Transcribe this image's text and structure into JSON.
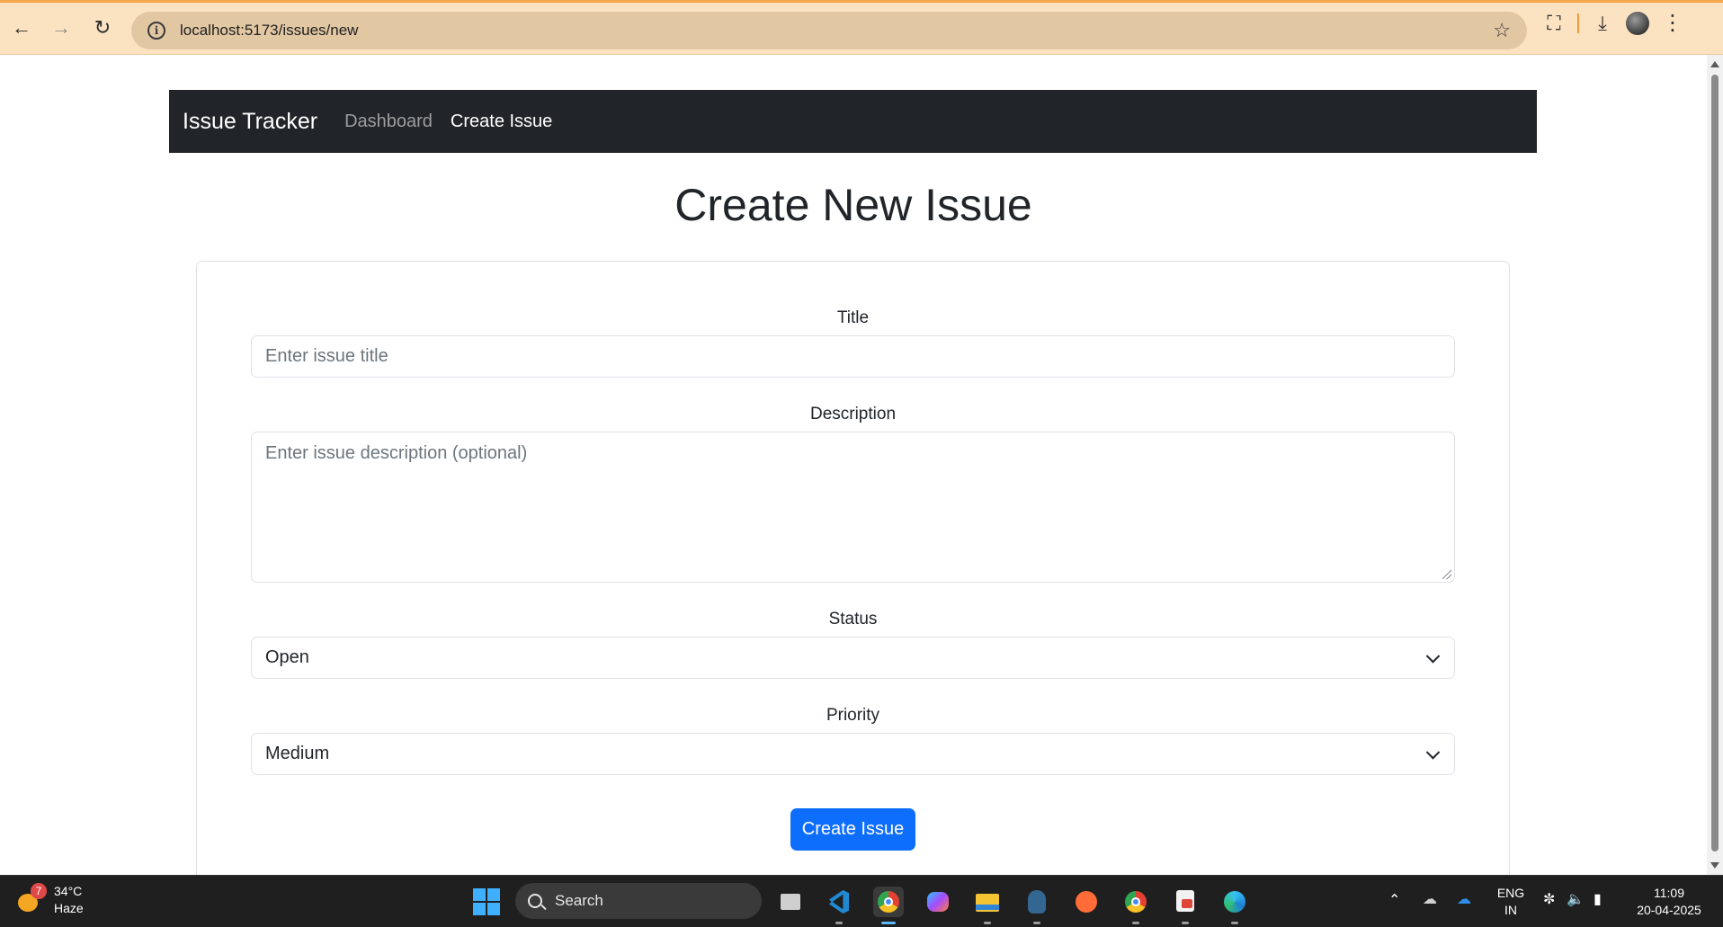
{
  "browser": {
    "url": "localhost:5173/issues/new",
    "back_icon": "arrow-left-icon",
    "forward_icon": "arrow-right-icon",
    "reload_icon": "reload-icon"
  },
  "navbar": {
    "brand": "Issue Tracker",
    "links": [
      {
        "label": "Dashboard",
        "active": false
      },
      {
        "label": "Create Issue",
        "active": true
      }
    ],
    "background": "#212529"
  },
  "page": {
    "title": "Create New Issue"
  },
  "form": {
    "title_label": "Title",
    "title_placeholder": "Enter issue title",
    "description_label": "Description",
    "description_placeholder": "Enter issue description (optional)",
    "status_label": "Status",
    "status_value": "Open",
    "priority_label": "Priority",
    "priority_value": "Medium",
    "submit_label": "Create Issue",
    "accent": "#0d6efd"
  },
  "taskbar": {
    "weather_badge": "7",
    "weather_temp": "34°C",
    "weather_desc": "Haze",
    "search_label": "Search",
    "language": "ENG",
    "region": "IN",
    "time": "11:09",
    "date": "20-04-2025"
  }
}
